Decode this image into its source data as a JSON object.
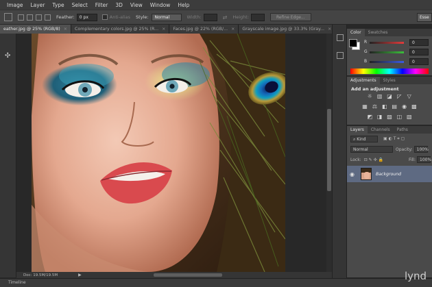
{
  "menu": [
    "Image",
    "Layer",
    "Type",
    "Select",
    "Filter",
    "3D",
    "View",
    "Window",
    "Help"
  ],
  "options": {
    "feather_label": "Feather:",
    "feather_value": "0 px",
    "antialias_label": "Anti-alias",
    "style_label": "Style:",
    "style_value": "Normal",
    "width_label": "Width:",
    "height_label": "Height:",
    "refine_label": "Refine Edge...",
    "workspace_value": "Esse"
  },
  "tabs": [
    {
      "label": "eather.jpg @ 25% (RGB/8)",
      "active": true
    },
    {
      "label": "Complementary colors.jpg @ 25% (R...",
      "active": false
    },
    {
      "label": "Faces.jpg @ 22% (RGB/...",
      "active": false
    },
    {
      "label": "Grayscale image.jpg @ 33.3% (Gray...",
      "active": false
    }
  ],
  "status": {
    "doc": "Doc: 19.5M/19.5M"
  },
  "timeline_label": "Timeline",
  "color_panel": {
    "tabs": [
      "Color",
      "Swatches"
    ],
    "rows": [
      {
        "label": "R",
        "value": "0",
        "color": "#e23b3b"
      },
      {
        "label": "G",
        "value": "0",
        "color": "#3bbf3b"
      },
      {
        "label": "B",
        "value": "0",
        "color": "#3b5ae2"
      }
    ]
  },
  "adjustments_panel": {
    "tabs": [
      "Adjustments",
      "Styles"
    ],
    "title": "Add an adjustment",
    "row1": [
      "☼",
      "▥",
      "◪",
      "◸",
      "▽"
    ],
    "row2": [
      "▦",
      "⚖",
      "◧",
      "▤",
      "◉",
      "▩"
    ],
    "row3": [
      "◩",
      "◨",
      "▨",
      "◫",
      "▧"
    ]
  },
  "layers_panel": {
    "tabs": [
      "Layers",
      "Channels",
      "Paths"
    ],
    "kind_label": "Kind",
    "blend_value": "Normal",
    "opacity_label": "Opacity:",
    "opacity_value": "100%",
    "lock_label": "Lock:",
    "fill_label": "Fill:",
    "fill_value": "100%",
    "layer_name": "Background"
  },
  "watermark": "lynd"
}
